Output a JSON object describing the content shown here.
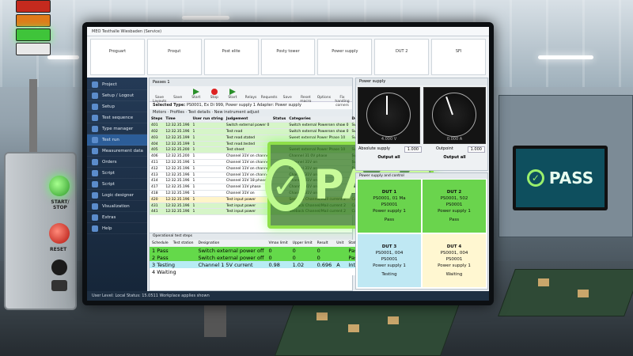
{
  "scene": {
    "colors": {
      "pass": "#64d94a",
      "testing": "#b7ecf4",
      "waiting": "#fff7d1",
      "sidebar": "#1b2f47"
    }
  },
  "control_box": {
    "start_stop_label": "START/ STOP",
    "reset_label": "RESET"
  },
  "app": {
    "title": "MEO Testhalle Wiesbaden (Service)",
    "toolstrip": [
      "Proguart",
      "Proqut",
      "Post elite",
      "Posty tower",
      "Power supply",
      "DUT 2",
      "SFI"
    ],
    "sidebar": [
      "Project",
      "Setup / Logout",
      "Setup",
      "Test sequence",
      "Type manager",
      "Test run",
      "Measurement data",
      "Orders",
      "Script",
      "Script",
      "Logic designer",
      "Visualization",
      "Extras",
      "Help"
    ],
    "panel_title": "Passes 1",
    "ribbon": [
      "Save Layouts",
      "Save",
      "Start",
      "Stop",
      "Start",
      "Relays",
      "Requests",
      "Save",
      "Reset macro",
      "Options",
      "Fix handing corners"
    ],
    "selected_type_label": "Selected Type:",
    "selected_type_value": "PS0001, Ex Di 999, Power supply 1",
    "selected_extra": "Adapter: Power supply",
    "grid_tabs": [
      "Motors",
      "Profiles",
      "Test details",
      "New instrument adjust"
    ],
    "grid_headers": [
      "Steps",
      "Time",
      "User run string",
      "Judgement",
      "Status",
      "Categories",
      "Descriptions",
      "Verdict",
      "Value"
    ],
    "grid_rows": [
      [
        "401",
        "12:32.35.196",
        "1",
        "Switch external power 0",
        "",
        "Switch external Powersen show 0",
        "Sweet & connect",
        "",
        "0%"
      ],
      [
        "402",
        "12:32.35.196",
        "1",
        "Test read",
        "",
        "Switch external Powersen show 0",
        "Sweet & connect",
        "",
        "0%"
      ],
      [
        "403",
        "12:32.35.199",
        "1",
        "Test read.stated",
        "",
        "Sweet external Power Phase 10",
        "Sweet & connect",
        "",
        "0%"
      ],
      [
        "404",
        "12:32.35.199",
        "1",
        "Test read.tested",
        "",
        "Sweet external Power Phase 10",
        "Sweet & connect",
        "",
        "0%"
      ],
      [
        "405",
        "12:32.35.200",
        "1",
        "Test sheet",
        "",
        "Sweet external Power Phase 10",
        "Sweet & connect",
        "",
        "0%"
      ],
      [
        "406",
        "12:32.35.200",
        "1",
        "Channel 31V on channel",
        "",
        "Channel 31 0V phase",
        "Sweet & connect",
        "",
        "0%"
      ],
      [
        "411",
        "12:32.35.196",
        "1",
        "Channel 11V on channel",
        "",
        "Channel 31V on",
        "Sweet & connect",
        "",
        "0%"
      ],
      [
        "412",
        "12:32.35.196",
        "1",
        "Channel 11V on channel",
        "",
        "Channel 31V on",
        "Sweet & connect",
        "",
        "0%"
      ],
      [
        "413",
        "12:32.35.196",
        "1",
        "Channel 11V on channel",
        "",
        "Channel 31V on",
        "Sweet & connect",
        "",
        "0%"
      ],
      [
        "414",
        "12:32.35.196",
        "1",
        "Channel 31V 18 phase",
        "",
        "Channel 31V on",
        "Sweet & connect",
        "",
        "0%"
      ],
      [
        "417",
        "12:32.35.196",
        "1",
        "Channel 11V phase",
        "",
        "Channel 31V on",
        "Sweet & connect",
        "",
        "0%"
      ],
      [
        "418",
        "12:32.35.196",
        "1",
        "Channel 31V on",
        "",
        "Channel 31V on",
        "Sweet & connect",
        "",
        "0%"
      ],
      [
        "420",
        "12:32.35.196",
        "1",
        "Test input power",
        "",
        "Seeback Channel/Mail current 2",
        "Current 1.5V current",
        "",
        "0.406"
      ],
      [
        "431",
        "12:32.35.196",
        "1",
        "Test input power",
        "",
        "Seeback Channel/Mail current 2",
        "Current 1.5V current",
        "",
        "0.406"
      ],
      [
        "441",
        "12:32.35.196",
        "1",
        "Test input power",
        "",
        "Seeback Channel/Mail current 2",
        "Current 1.5V current",
        "",
        "0.406"
      ]
    ],
    "pass_overlay_text": "PASS",
    "steps_title": "Operational test steps",
    "steps_headers": [
      "Schedule",
      "Test station",
      "Designation",
      "Vmax limit",
      "Upper limit",
      "Result",
      "Unit",
      "Status"
    ],
    "steps": [
      {
        "n": "1",
        "state": "Pass",
        "desc": "Switch external power off",
        "low": "0",
        "high": "0",
        "val": "0",
        "unit": "",
        "status": "Pass"
      },
      {
        "n": "2",
        "state": "Pass",
        "desc": "Switch external power off",
        "low": "0",
        "high": "0",
        "val": "0",
        "unit": "",
        "status": "Pass"
      },
      {
        "n": "3",
        "state": "Testing",
        "desc": "Channel 1 5V current",
        "low": "0.98",
        "high": "1.02",
        "val": "0.696",
        "unit": "A",
        "status": "Interne..."
      },
      {
        "n": "4",
        "state": "Waiting",
        "desc": "",
        "low": "",
        "high": "",
        "val": "",
        "unit": "",
        "status": ""
      }
    ],
    "power_supply_title": "Power supply",
    "gauge_left": {
      "unit": "Volt Vdc",
      "reading": "4.000 V",
      "needle_frac": 0.5
    },
    "gauge_right": {
      "unit": "Volt mA",
      "reading": "0.000 A",
      "needle_frac": 0.42
    },
    "voltage_label": "Absolute supply",
    "voltage_value": "1.000",
    "current_label": "Outpoint",
    "current_value": "1.000",
    "output_left": "Output all",
    "output_right": "Output all",
    "dut_title": "Power supply and control",
    "duts": [
      {
        "name": "DUT 1",
        "lines": [
          "PS0001, 01 Ma",
          "PS0001",
          "Power supply 1"
        ],
        "state": "Pass"
      },
      {
        "name": "DUT 2",
        "lines": [
          "PS0001, 502",
          "PS0001",
          "Power supply 1"
        ],
        "state": "Pass"
      },
      {
        "name": "DUT 3",
        "lines": [
          "PS0001, 004",
          "PS0001",
          "Power supply 1"
        ],
        "state": "Testing"
      },
      {
        "name": "DUT 4",
        "lines": [
          "PS0001, 004",
          "PS0001",
          "Power supply 1"
        ],
        "state": "Waiting"
      }
    ],
    "status_bar": "Last test: Test progress",
    "status_bar2": "User Level: Local   Status: 15.0511 Workplace applies shown"
  },
  "mini_monitor": {
    "text": "PASS"
  }
}
